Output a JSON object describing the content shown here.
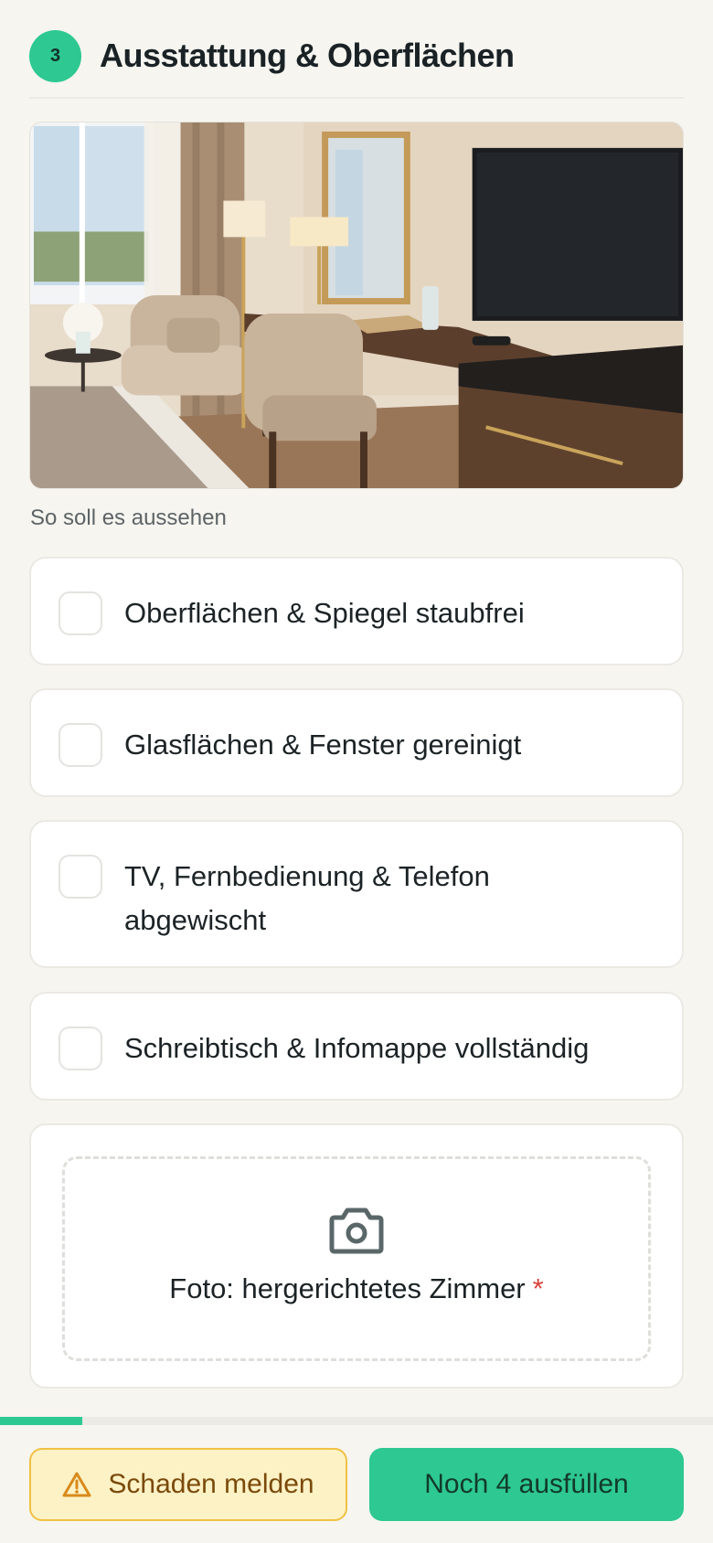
{
  "section": {
    "step_number": "3",
    "title": "Ausstattung & Oberflächen"
  },
  "reference_image": {
    "caption": "So soll es aussehen"
  },
  "checklist": [
    {
      "label": "Oberflächen & Spiegel staubfrei",
      "checked": false
    },
    {
      "label": "Glasflächen & Fenster gereinigt",
      "checked": false
    },
    {
      "label": "TV, Fernbedienung & Telefon abgewischt",
      "checked": false
    },
    {
      "label": "Schreibtisch & Infomappe vollständig",
      "checked": false
    }
  ],
  "photo_upload": {
    "label": "Foto: hergerichtetes Zimmer",
    "required_marker": "*",
    "icon": "camera-icon"
  },
  "progress": {
    "fraction": 0.115
  },
  "footer": {
    "report_label": "Schaden melden",
    "report_icon": "warning-icon",
    "complete_label": "Noch 4 ausfüllen"
  },
  "colors": {
    "accent": "#2ec892",
    "warning_bg": "#fdf2c6",
    "warning_border": "#f0c143",
    "warning_text": "#7a4a0a",
    "required": "#d9433d",
    "background": "#f6f5f0"
  }
}
